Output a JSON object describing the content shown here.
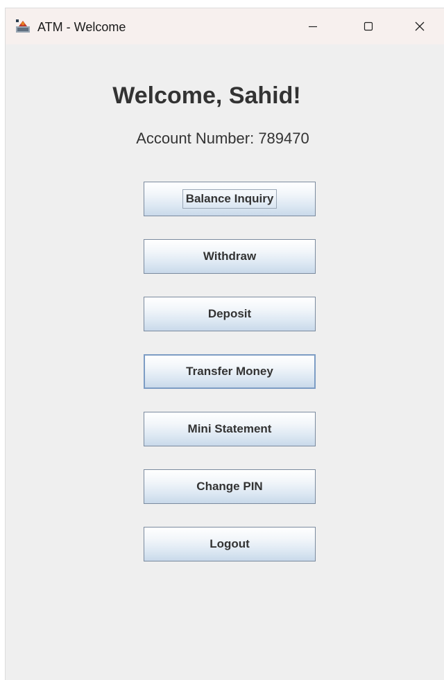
{
  "window": {
    "title": "ATM - Welcome",
    "icons": {
      "app": "java-app-icon",
      "minimize": "minimize-icon",
      "maximize": "maximize-icon",
      "close": "close-icon"
    }
  },
  "main": {
    "welcome_text": "Welcome, Sahid!",
    "account_text": "Account Number: 789470"
  },
  "menu": {
    "buttons": [
      {
        "label": "Balance Inquiry",
        "focused": true
      },
      {
        "label": "Withdraw"
      },
      {
        "label": "Deposit"
      },
      {
        "label": "Transfer Money",
        "hovered": true
      },
      {
        "label": "Mini Statement"
      },
      {
        "label": "Change PIN"
      },
      {
        "label": "Logout"
      }
    ]
  },
  "colors": {
    "window_bg": "#efefef",
    "titlebar_bg": "#f7f0ee",
    "text": "#333333",
    "button_border": "#7a8a9e"
  }
}
